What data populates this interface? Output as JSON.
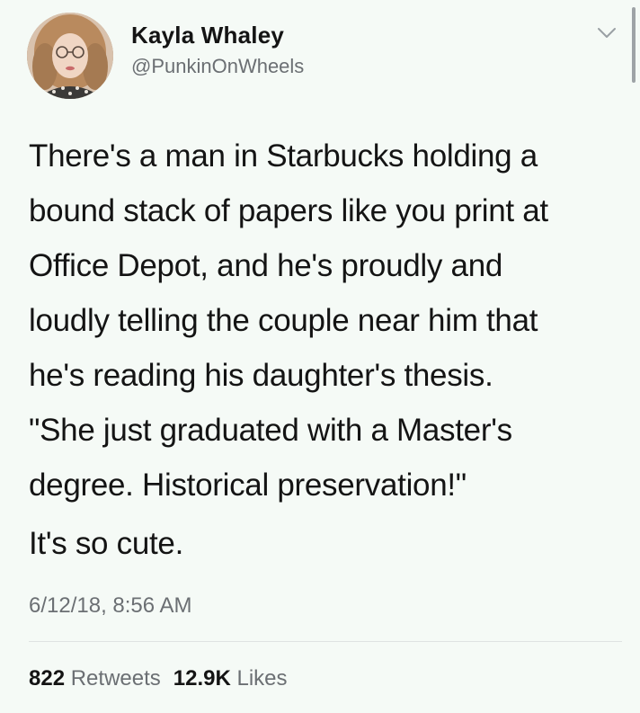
{
  "user": {
    "name": "Kayla Whaley",
    "handle": "@PunkinOnWheels"
  },
  "tweet": {
    "lines": [
      "There's a man in Starbucks holding a",
      "bound stack of papers like you print at",
      "Office Depot, and he's proudly and",
      "loudly telling the couple near him that",
      "he's reading his daughter's thesis.",
      "\"She just graduated with a Master's",
      "degree. Historical preservation!\""
    ],
    "second_paragraph": "It's so cute.",
    "timestamp": "6/12/18, 8:56 AM"
  },
  "stats": {
    "retweets_count": "822",
    "retweets_label": "Retweets",
    "likes_count": "12.9K",
    "likes_label": "Likes"
  },
  "icons": {
    "menu": "chevron-down-icon"
  },
  "colors": {
    "background": "#f5faf6",
    "text": "#141414",
    "secondary_text": "#6b6f73"
  }
}
